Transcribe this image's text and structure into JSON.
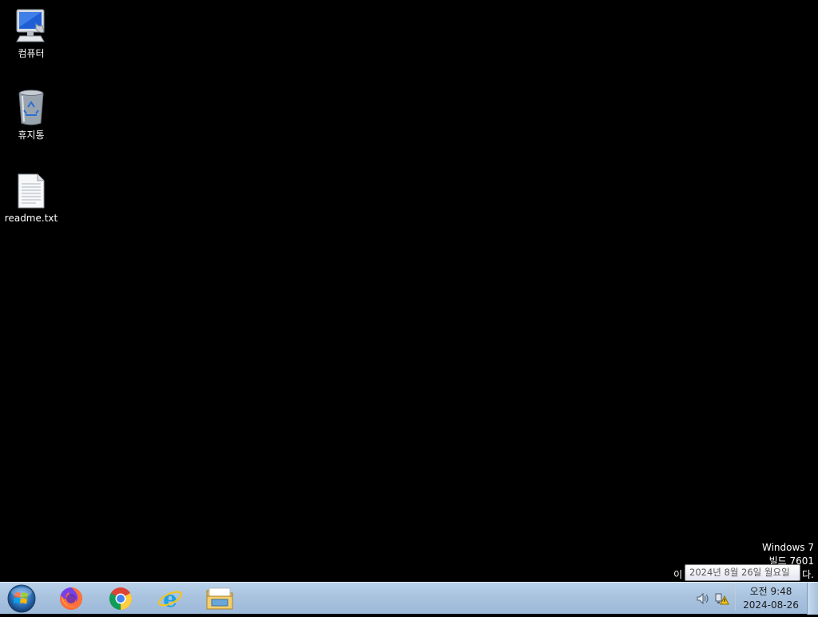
{
  "desktop": {
    "icons": [
      {
        "label": "컴퓨터",
        "icon": "computer-icon"
      },
      {
        "label": "휴지통",
        "icon": "recycle-bin-icon"
      },
      {
        "label": "readme.txt",
        "icon": "text-file-icon"
      }
    ],
    "watermark": {
      "line1": "Windows 7",
      "line2": "빌드 7601",
      "line3_start": "이",
      "line3_end": "다."
    }
  },
  "tooltip": {
    "text": "2024년 8월 26일 월요일"
  },
  "taskbar": {
    "start_icon": "windows-start-orb-icon",
    "pinned_apps": [
      {
        "name": "Firefox",
        "icon": "firefox-icon"
      },
      {
        "name": "Google Chrome",
        "icon": "chrome-icon"
      },
      {
        "name": "Internet Explorer",
        "icon": "internet-explorer-icon"
      },
      {
        "name": "Windows Explorer",
        "icon": "file-explorer-icon"
      }
    ],
    "tray": {
      "icons": [
        "volume-icon",
        "network-warning-icon"
      ],
      "time": "오전 9:48",
      "date": "2024-08-26"
    }
  },
  "colors": {
    "desktop_background": "#000000",
    "taskbar": "#a9c3df",
    "text": "#ffffff"
  }
}
